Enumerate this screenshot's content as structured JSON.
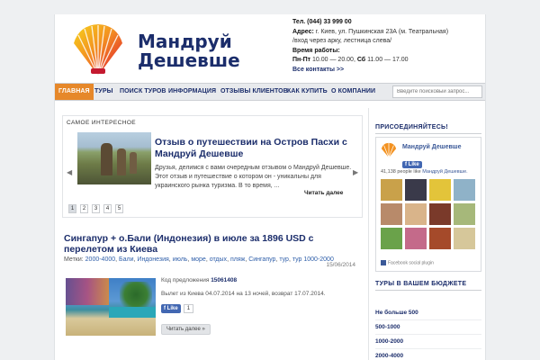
{
  "brand": {
    "line1": "Мандруй",
    "line2": "Дешевше"
  },
  "contacts": {
    "phone": "Тел. (044) 33 999 00",
    "address_label": "Адрес:",
    "address": "г. Киев, ул. Пушкинская 23А (м. Театральная)",
    "address2": "/вход через арку, лестница слева/",
    "hours_label": "Время работы:",
    "hours_weekdays_label": "Пн-Пт",
    "hours_weekdays": "10.00 — 20.00,",
    "hours_sat_label": "Сб",
    "hours_sat": "11.00 — 17.00",
    "all_contacts": "Все контакты >>"
  },
  "nav": {
    "items": [
      "Главная",
      "Туры",
      "Поиск туров",
      "Информация",
      "Отзывы клиентов",
      "Как купить",
      "О компании"
    ],
    "search_placeholder": "Введите поисковый запрос..."
  },
  "featured": {
    "section_title": "Самое интересное",
    "heading": "Отзыв о путешествии на Остров Пасхи с Мандруй Дешевше",
    "excerpt": "Друзья, делимся с вами очередным отзывом о Мандруй Дешевше. Этот отзыв и путешествие о котором он - уникальны для украинского рынка туризма. В то время, ...",
    "read_more": "Читать далее",
    "pages": [
      "1",
      "2",
      "3",
      "4",
      "5"
    ],
    "active_page": "1"
  },
  "article": {
    "title": "Сингапур + о.Бали (Индонезия) в июле за 1896 USD с перелетом из Киева",
    "tags_label": "Метки:",
    "tags": [
      "2000-4000",
      "Бали",
      "Индонезия",
      "июль",
      "море",
      "отдых",
      "пляж",
      "Сингапур",
      "тур",
      "тур 1000-2000"
    ],
    "date": "15/06/2014",
    "code_label": "Код предложения",
    "code": "15061408",
    "departure": "Вылет из Киева 04.07.2014 на 13 ночей, возврат 17.07.2014.",
    "like_label": "Like",
    "like_count": "1",
    "read_more": "Читать далее »"
  },
  "sidebar": {
    "join_title": "Присоединяйтесь!",
    "fb_page_name": "Мандруй Дешевше",
    "fb_like_label": "Like",
    "fb_count_text": "41,138 people like",
    "fb_count_link": "Мандруй Дешевше.",
    "fb_plugin_text": "Facebook social plugin",
    "budget_title": "Туры в вашем бюджете",
    "budget_items": [
      "Не больше 500",
      "500-1000",
      "1000-2000",
      "2000-4000"
    ]
  },
  "colors": {
    "nav_active": "#e6882a",
    "brand_blue": "#1b2d6b",
    "link_blue": "#2e5ea9",
    "facebook_blue": "#4267b2"
  }
}
